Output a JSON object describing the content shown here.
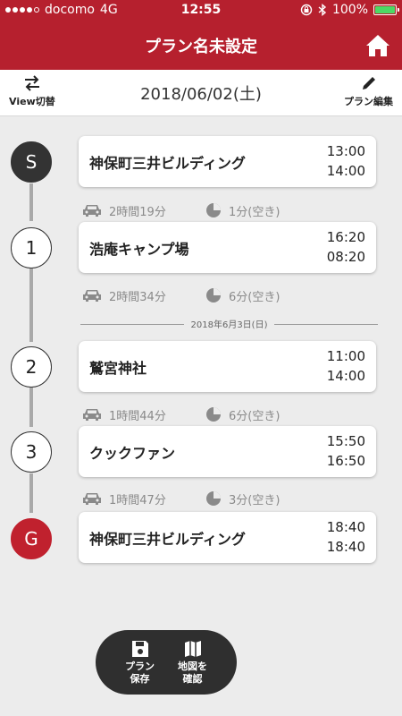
{
  "status_bar": {
    "carrier": "docomo",
    "network": "4G",
    "time": "12:55",
    "battery": "100%"
  },
  "nav": {
    "title": "プラン名未設定",
    "home_icon": "home-icon"
  },
  "toolbar": {
    "view_toggle_label": "View切替",
    "date": "2018/06/02(土)",
    "edit_label": "プラン編集"
  },
  "stops": [
    {
      "marker": "S",
      "name": "神保町三井ビルディング",
      "arrive": "13:00",
      "depart": "14:00"
    },
    {
      "marker": "1",
      "name": "浩庵キャンプ場",
      "arrive": "16:20",
      "depart": "08:20"
    },
    {
      "marker": "2",
      "name": "鷲宮神社",
      "arrive": "11:00",
      "depart": "14:00"
    },
    {
      "marker": "3",
      "name": "クックファン",
      "arrive": "15:50",
      "depart": "16:50"
    },
    {
      "marker": "G",
      "name": "神保町三井ビルディング",
      "arrive": "18:40",
      "depart": "18:40"
    }
  ],
  "legs": [
    {
      "duration": "2時間19分",
      "slack": "1分(空き)"
    },
    {
      "duration": "2時間34分",
      "slack": "6分(空き)"
    },
    {
      "duration": "1時間44分",
      "slack": "6分(空き)"
    },
    {
      "duration": "1時間47分",
      "slack": "3分(空き)"
    }
  ],
  "day_separator": "2018年6月3日(日)",
  "bottom_bar": {
    "save_label_1": "プラン",
    "save_label_2": "保存",
    "map_label_1": "地図を",
    "map_label_2": "確認"
  },
  "colors": {
    "brand_red": "#b6202e",
    "goal_red": "#c0212e",
    "start_dark": "#333333",
    "battery_green": "#4cd964"
  }
}
